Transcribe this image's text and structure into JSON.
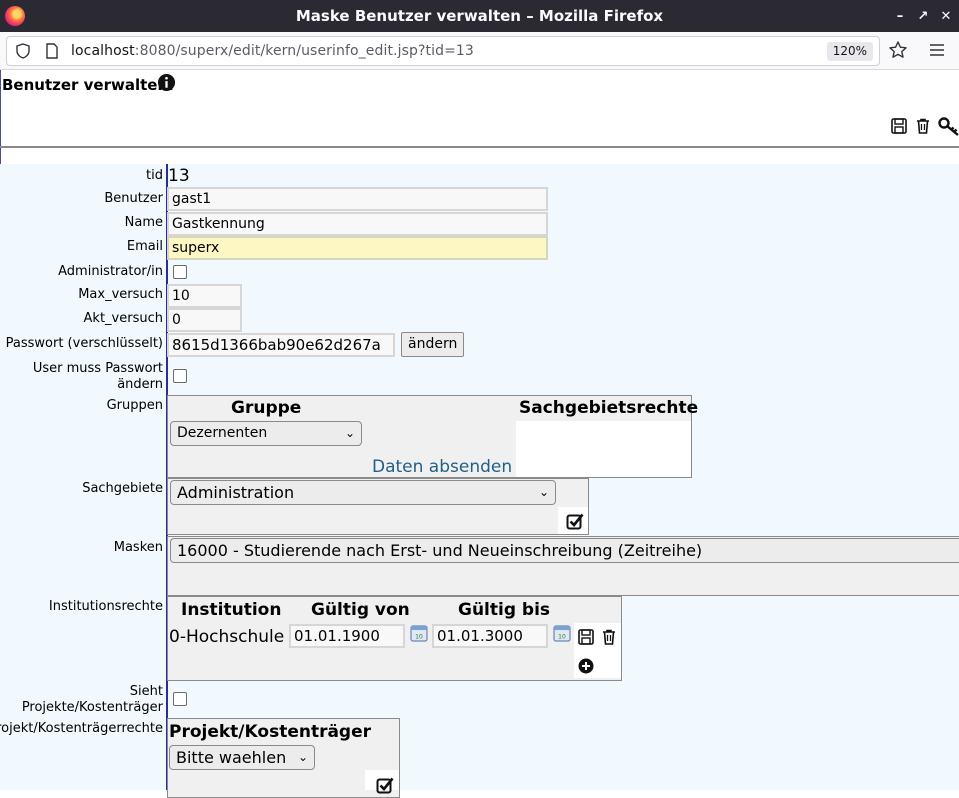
{
  "window": {
    "title": "Maske Benutzer verwalten – Mozilla Firefox"
  },
  "browser": {
    "url_host": "localhost",
    "url_rest": ":8080/superx/edit/kern/userinfo_edit.jsp?tid=13",
    "zoom": "120%"
  },
  "page": {
    "title": "Benutzer verwalten."
  },
  "form": {
    "tid": {
      "label": "tid",
      "value": "13"
    },
    "benutzer": {
      "label": "Benutzer",
      "value": "gast1"
    },
    "name": {
      "label": "Name",
      "value": "Gastkennung"
    },
    "email": {
      "label": "Email",
      "value": "superx"
    },
    "admin": {
      "label": "Administrator/in"
    },
    "max_versuch": {
      "label": "Max_versuch",
      "value": "10"
    },
    "akt_versuch": {
      "label": "Akt_versuch",
      "value": "0"
    },
    "passwort": {
      "label": "Passwort (verschlüsselt)",
      "value": "8615d1366bab90e62d267a",
      "button": "ändern"
    },
    "user_muss": {
      "label_line1": "User muss Passwort",
      "label_line2": "ändern"
    },
    "gruppen": {
      "label": "Gruppen",
      "col_gruppe": "Gruppe",
      "col_sachgebietsrechte": "Sachgebietsrechte",
      "selected": "Dezernenten",
      "submit": "Daten absenden"
    },
    "sachgebiete": {
      "label": "Sachgebiete",
      "selected": "Administration"
    },
    "masken": {
      "label": "Masken",
      "selected": "16000 - Studierende nach Erst- und Neueinschreibung (Zeitreihe)"
    },
    "institutionsrechte": {
      "label": "Institutionsrechte",
      "col_institution": "Institution",
      "col_von": "Gültig von",
      "col_bis": "Gültig bis",
      "institution": "0-Hochschule",
      "von": "01.01.1900",
      "bis": "01.01.3000"
    },
    "sieht_projekte": {
      "label_line1": "Sieht",
      "label_line2": "Projekte/Kostenträger"
    },
    "projektrechte": {
      "label": "Projekt/Kostenträgerrechte",
      "col": "Projekt/Kostenträger",
      "selected": "Bitte waehlen"
    }
  }
}
